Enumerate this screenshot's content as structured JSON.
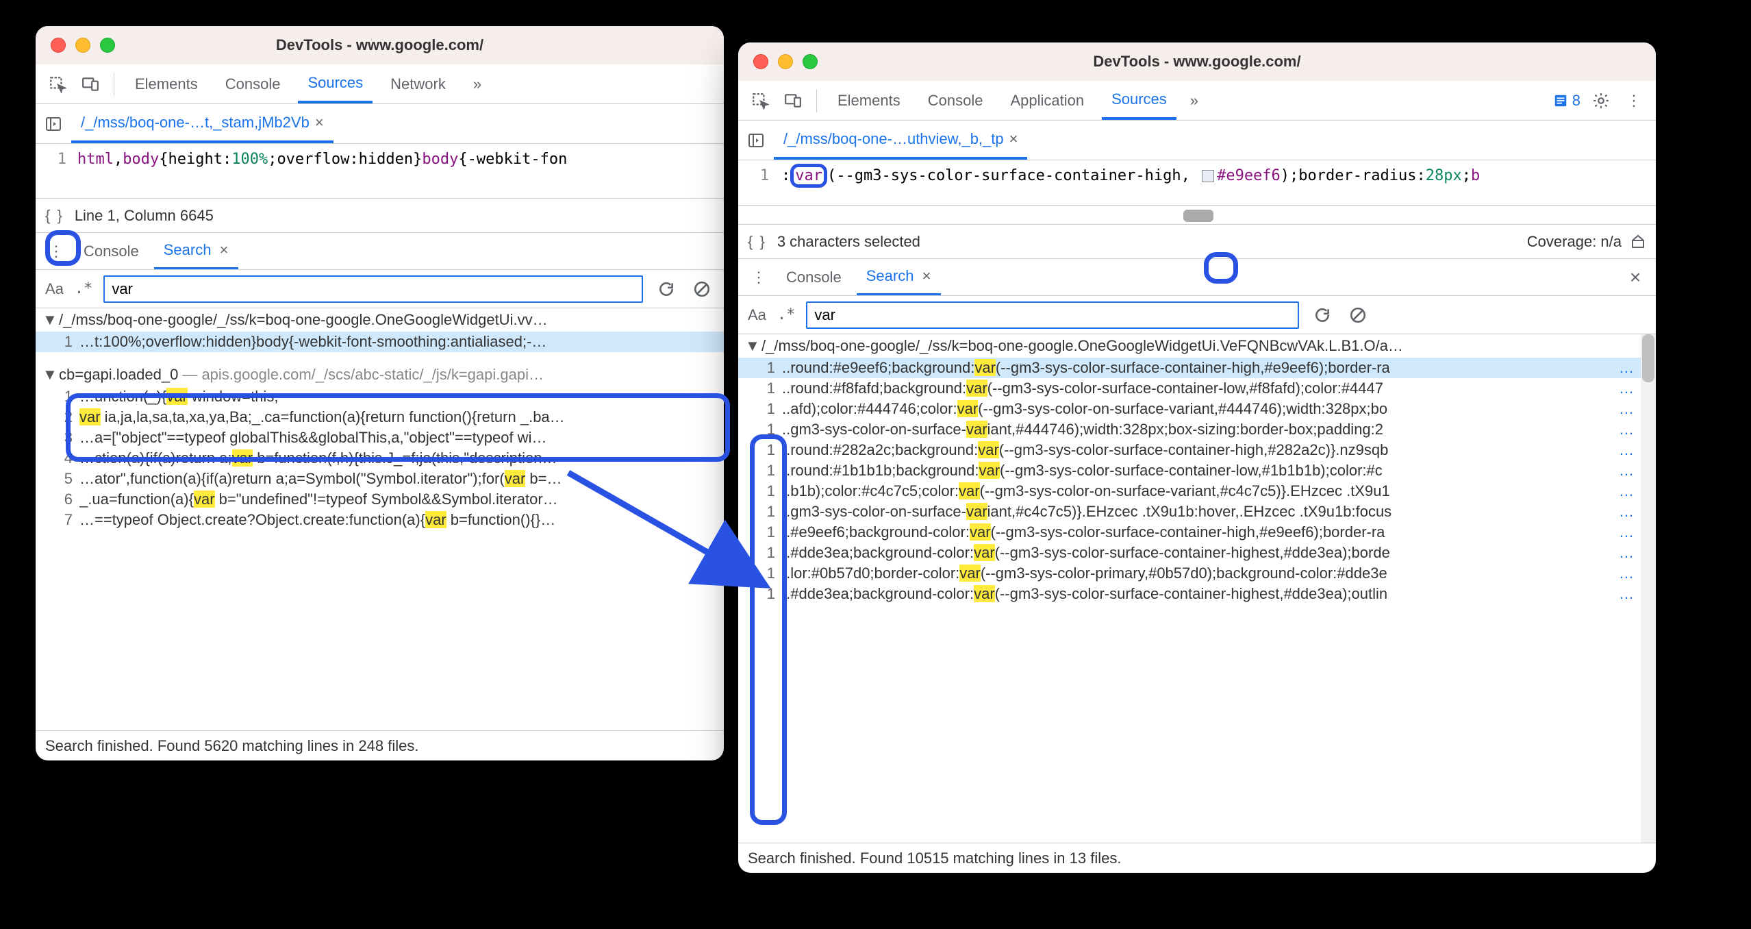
{
  "left": {
    "title": "DevTools - www.google.com/",
    "tabs": [
      "Elements",
      "Console",
      "Sources",
      "Network"
    ],
    "activeTab": "Sources",
    "more": "»",
    "fileTab": "/_/mss/boq-one-…t,_stam,jMb2Vb",
    "code": {
      "line": "1",
      "seg_html": "html",
      "seg_sep1": ",",
      "seg_body": "body",
      "seg_open": "{",
      "seg_height": "height",
      "seg_colon1": ":",
      "seg_100": "100%",
      "seg_semi1": ";",
      "seg_overflow": "overflow",
      "seg_colon2": ":",
      "seg_hidden": "hidden",
      "seg_close": "}",
      "seg_body2": "body",
      "seg_open2": "{",
      "seg_webkit": "-webkit-fon"
    },
    "status": {
      "braces": "{ }",
      "pos": "Line 1, Column 6645"
    },
    "drawer": {
      "console": "Console",
      "search": "Search"
    },
    "search": {
      "Aa": "Aa",
      "regex": ".*",
      "value": "var"
    },
    "results": {
      "file1": "/_/mss/boq-one-google/_/ss/k=boq-one-google.OneGoogleWidgetUi.vv…",
      "file1_rows": [
        {
          "ln": "1",
          "pre": "…t:100%;overflow:hidden}body{-webkit-font-smoothing:antialiased;-…"
        }
      ],
      "file2_name": "cb=gapi.loaded_0",
      "file2_hint": "— apis.google.com/_/scs/abc-static/_/js/k=gapi.gapi…",
      "file2_rows": [
        {
          "ln": "1",
          "a": "…unction(_){",
          "b": "var",
          "c": " window=this;"
        },
        {
          "ln": "2",
          "a": "",
          "b": "var",
          "c": " ia,ja,la,sa,ta,xa,ya,Ba;_.ca=function(a){return function(){return _.ba…"
        },
        {
          "ln": "3",
          "a": "…a=[\"object\"==typeof globalThis&&globalThis,a,\"object\"==typeof wi…",
          "b": "",
          "c": ""
        },
        {
          "ln": "4",
          "a": "…ction(a){if(a)return a;",
          "b": "var",
          "c": " b=function(f,h){this.J_=f;ja(this,\"description…"
        },
        {
          "ln": "5",
          "a": "…ator\",function(a){if(a)return a;a=Symbol(\"Symbol.iterator\");for(",
          "b": "var",
          "c": " b=…"
        },
        {
          "ln": "6",
          "a": "_.ua=function(a){",
          "b": "var",
          "c": " b=\"undefined\"!=typeof Symbol&&Symbol.iterator…"
        },
        {
          "ln": "7",
          "a": "…==typeof Object.create?Object.create:function(a){",
          "b": "var",
          "c": " b=function(){}…"
        }
      ]
    },
    "footer": "Search finished.  Found 5620 matching lines in 248 files."
  },
  "right": {
    "title": "DevTools - www.google.com/",
    "tabs": [
      "Elements",
      "Console",
      "Application",
      "Sources"
    ],
    "activeTab": "Sources",
    "more": "»",
    "badge": "8",
    "fileTab": "/_/mss/boq-one-…uthview,_b,_tp",
    "code": {
      "line": "1",
      "seg_colon": ":",
      "seg_var": "var",
      "seg_open": "(",
      "seg_cssvar": "--gm3-sys-color-surface-container-high",
      "seg_comma": ", ",
      "seg_hex": "#e9eef6",
      "seg_close": ");",
      "seg_br": "border-radius",
      "seg_colon2": ":",
      "seg_px": "28px",
      "seg_semi": ";",
      "seg_b": "b"
    },
    "status": {
      "braces": "{ }",
      "sel": "3 characters selected",
      "cov": "Coverage: n/a"
    },
    "drawer": {
      "console": "Console",
      "search": "Search"
    },
    "search": {
      "Aa": "Aa",
      "regex": ".*",
      "value": "var"
    },
    "results": {
      "file": "/_/mss/boq-one-google/_/ss/k=boq-one-google.OneGoogleWidgetUi.VeFQNBcwVAk.L.B1.O/a…",
      "rows": [
        {
          "ln": "1",
          "a": "..round:#e9eef6;background:",
          "b": "var",
          "c": "(--gm3-sys-color-surface-container-high,#e9eef6);border-ra",
          "more": "…"
        },
        {
          "ln": "1",
          "a": "..round:#f8fafd;background:",
          "b": "var",
          "c": "(--gm3-sys-color-surface-container-low,#f8fafd);color:#4447",
          "more": "…"
        },
        {
          "ln": "1",
          "a": "..afd);color:#444746;color:",
          "b": "var",
          "c": "(--gm3-sys-color-on-surface-variant,#444746);width:328px;bo",
          "more": "…"
        },
        {
          "ln": "1",
          "a": "..gm3-sys-color-on-surface-",
          "b": "var",
          "c": "iant,#444746);width:328px;box-sizing:border-box;padding:2",
          "more": "…"
        },
        {
          "ln": "1",
          "a": "..round:#282a2c;background:",
          "b": "var",
          "c": "(--gm3-sys-color-surface-container-high,#282a2c)}.nz9sqb",
          "more": "…"
        },
        {
          "ln": "1",
          "a": "..round:#1b1b1b;background:",
          "b": "var",
          "c": "(--gm3-sys-color-surface-container-low,#1b1b1b);color:#c",
          "more": "…"
        },
        {
          "ln": "1",
          "a": "..b1b);color:#c4c7c5;color:",
          "b": "var",
          "c": "(--gm3-sys-color-on-surface-variant,#c4c7c5)}.EHzcec .tX9u1",
          "more": "…"
        },
        {
          "ln": "1",
          "a": "..gm3-sys-color-on-surface-",
          "b": "var",
          "c": "iant,#c4c7c5)}.EHzcec .tX9u1b:hover,.EHzcec .tX9u1b:focus",
          "more": "…"
        },
        {
          "ln": "1",
          "a": "..#e9eef6;background-color:",
          "b": "var",
          "c": "(--gm3-sys-color-surface-container-high,#e9eef6);border-ra",
          "more": "…"
        },
        {
          "ln": "1",
          "a": "..#dde3ea;background-color:",
          "b": "var",
          "c": "(--gm3-sys-color-surface-container-highest,#dde3ea);borde",
          "more": "…"
        },
        {
          "ln": "1",
          "a": "..lor:#0b57d0;border-color:",
          "b": "var",
          "c": "(--gm3-sys-color-primary,#0b57d0);background-color:#dde3e",
          "more": "…"
        },
        {
          "ln": "1",
          "a": "..#dde3ea;background-color:",
          "b": "var",
          "c": "(--gm3-sys-color-surface-container-highest,#dde3ea);outlin",
          "more": "…"
        }
      ]
    },
    "footer": "Search finished.  Found 10515 matching lines in 13 files."
  }
}
